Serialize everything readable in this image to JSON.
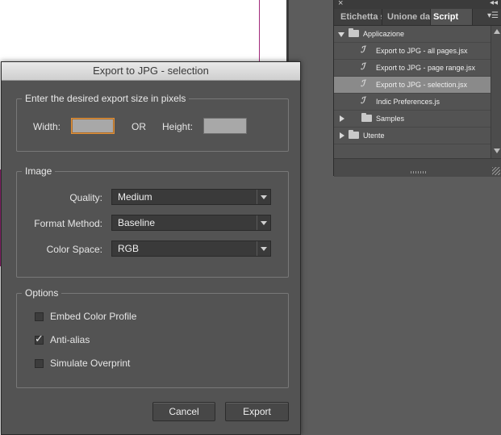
{
  "dialog": {
    "title": "Export to JPG - selection",
    "size_group": {
      "legend": "Enter the desired export size in pixels",
      "width_label": "Width:",
      "width_value": "",
      "or_label": "OR",
      "height_label": "Height:",
      "height_value": ""
    },
    "image_group": {
      "legend": "Image",
      "quality_label": "Quality:",
      "quality_value": "Medium",
      "format_label": "Format Method:",
      "format_value": "Baseline",
      "colorspace_label": "Color Space:",
      "colorspace_value": "RGB"
    },
    "options_group": {
      "legend": "Options",
      "embed_label": "Embed Color Profile",
      "embed_checked": false,
      "antialias_label": "Anti-alias",
      "antialias_checked": true,
      "overprint_label": "Simulate Overprint",
      "overprint_checked": false
    },
    "cancel_label": "Cancel",
    "export_label": "Export"
  },
  "panel": {
    "close_glyph": "×",
    "collapse_glyph": "◂◂",
    "tabs": [
      "Etichetta s",
      "Unione da",
      "Script"
    ],
    "active_tab": "Script",
    "menu_glyph": "▾☰",
    "tree": [
      {
        "label": "Applicazione",
        "type": "folder",
        "expanded": true
      },
      {
        "label": "Export to JPG - all pages.jsx",
        "type": "script"
      },
      {
        "label": "Export to JPG - page range.jsx",
        "type": "script"
      },
      {
        "label": "Export to JPG - selection.jsx",
        "type": "script",
        "selected": true
      },
      {
        "label": "Indic Preferences.js",
        "type": "script"
      },
      {
        "label": "Samples",
        "type": "folder",
        "expanded": false
      },
      {
        "label": "Utente",
        "type": "folder",
        "expanded": false
      }
    ]
  },
  "colors": {
    "focus_ring": "#e0913b",
    "selected_row": "#8a8a8a",
    "margin_guide": "#a0287a"
  }
}
